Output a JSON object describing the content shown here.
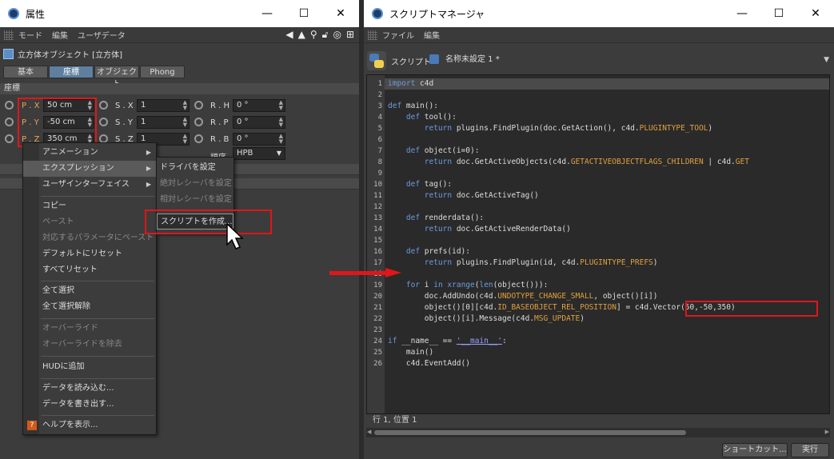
{
  "left_window": {
    "title": "属性",
    "menu": [
      "モード",
      "編集",
      "ユーザデータ"
    ],
    "object_title": "立方体オブジェクト [立方体]",
    "tabs": [
      "基本",
      "座標",
      "オブジェクト",
      "Phong"
    ],
    "active_tab": "座標",
    "section": "座標",
    "coords": [
      {
        "label": "P . X",
        "value": "50 cm",
        "slabel": "S . X",
        "svalue": "1",
        "rlabel": "R . H",
        "rvalue": "0 °"
      },
      {
        "label": "P . Y",
        "value": "-50 cm",
        "slabel": "S . Y",
        "svalue": "1",
        "rlabel": "R . P",
        "rvalue": "0 °"
      },
      {
        "label": "P . Z",
        "value": "350 cm",
        "slabel": "S . Z",
        "svalue": "1",
        "rlabel": "R . B",
        "rvalue": "0 °"
      }
    ],
    "order_label": "順序",
    "order_value": "HPB",
    "context_menu": {
      "items": [
        {
          "label": "アニメーション",
          "submenu": true,
          "enabled": true
        },
        {
          "label": "エクスプレッション",
          "submenu": true,
          "enabled": true,
          "selected": true
        },
        {
          "label": "ユーザインターフェイス",
          "submenu": true,
          "enabled": true
        },
        {
          "label": "コピー",
          "enabled": true
        },
        {
          "label": "ペースト",
          "enabled": false
        },
        {
          "label": "対応するパラメータにペースト",
          "enabled": false
        },
        {
          "label": "デフォルトにリセット",
          "enabled": true
        },
        {
          "label": "すべてリセット",
          "enabled": true
        },
        {
          "label": "全て選択",
          "enabled": true
        },
        {
          "label": "全て選択解除",
          "enabled": true
        },
        {
          "label": "オーバーライド",
          "enabled": false
        },
        {
          "label": "オーバーライドを除去",
          "enabled": false
        },
        {
          "label": "HUDに追加",
          "enabled": true
        },
        {
          "label": "データを読み込む...",
          "enabled": true
        },
        {
          "label": "データを書き出す...",
          "enabled": true
        },
        {
          "label": "ヘルプを表示...",
          "enabled": true
        }
      ]
    },
    "submenu": {
      "items": [
        {
          "label": "ドライバを設定",
          "enabled": true
        },
        {
          "label": "絶対レシーバを設定",
          "enabled": false
        },
        {
          "label": "相対レシーバを設定",
          "enabled": false
        },
        {
          "label": "スクリプトを作成...",
          "enabled": true,
          "highlighted": true
        }
      ]
    }
  },
  "right_window": {
    "title": "スクリプトマネージャ",
    "menu": [
      "ファイル",
      "編集"
    ],
    "script_label": "スクリプト",
    "script_name": "名称未設定 1 *",
    "code_lines": [
      "import c4d",
      "",
      "def main():",
      "    def tool():",
      "        return plugins.FindPlugin(doc.GetAction(), c4d.PLUGINTYPE_TOOL)",
      "",
      "    def object(i=0):",
      "        return doc.GetActiveObjects(c4d.GETACTIVEOBJECTFLAGS_CHILDREN | c4d.GET",
      "",
      "    def tag():",
      "        return doc.GetActiveTag()",
      "",
      "    def renderdata():",
      "        return doc.GetActiveRenderData()",
      "",
      "    def prefs(id):",
      "        return plugins.FindPlugin(id, c4d.PLUGINTYPE_PREFS)",
      "",
      "    for i in xrange(len(object())):",
      "        doc.AddUndo(c4d.UNDOTYPE_CHANGE_SMALL, object()[i])",
      "        object()[0][c4d.ID_BASEOBJECT_REL_POSITION] = c4d.Vector(50,-50,350)",
      "        object()[i].Message(c4d.MSG_UPDATE)",
      "",
      "if __name__ == '__main__':",
      "    main()",
      "    c4d.EventAdd()"
    ],
    "status": "行 1, 位置 1",
    "buttons": {
      "shortcut": "ショートカット...",
      "run": "実行"
    }
  },
  "colors": {
    "highlight_red": "#e0161a",
    "param_orange": "#f0a05a"
  }
}
